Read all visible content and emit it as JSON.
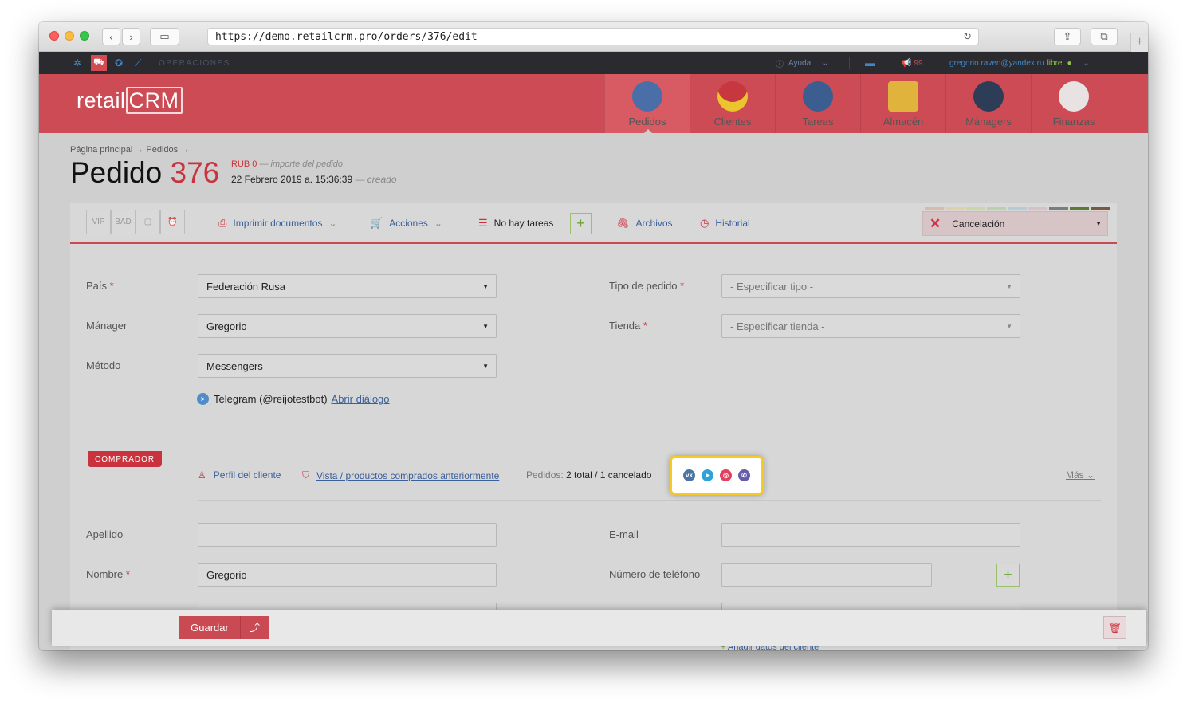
{
  "browser": {
    "url": "https://demo.retailcrm.pro/orders/376/edit",
    "back_icon": "chevron-left-icon",
    "forward_icon": "chevron-right-icon"
  },
  "topnav": {
    "section": "OPERACIONES",
    "help": "Ayuda",
    "notifications": "99",
    "user_email": "gregorio.raven@yandex.ru",
    "user_status": "libre"
  },
  "header": {
    "logo": "retailCRM",
    "modules": [
      "Pedidos",
      "Clientes",
      "Tareas",
      "Almacén",
      "Mánagers",
      "Finanzas"
    ]
  },
  "page": {
    "breadcrumb": "Página principal → Pedidos →",
    "title": "Pedido",
    "order_number": "376",
    "amount": "RUB 0",
    "amount_note": "— importe del pedido",
    "created": "22 Febrero 2019 a. 15:36:39",
    "created_note": "— creado"
  },
  "toolbar": {
    "flags": [
      "VIP",
      "BAD"
    ],
    "print": "Imprimir documentos",
    "actions": "Acciones",
    "tasks": "No hay tareas",
    "files": "Archivos",
    "history": "Historial",
    "status": "Cancelación",
    "status_colors": [
      "#d9b9a7",
      "#e1cfa6",
      "#cbd6a5",
      "#b9d3a8",
      "#b3cdd6",
      "#d9c0c4",
      "#7c7c7c",
      "#5b7a3a",
      "#7a5a3a"
    ]
  },
  "form": {
    "country_label": "País",
    "country_value": "Federación Rusa",
    "manager_label": "Mánager",
    "manager_value": "Gregorio",
    "method_label": "Método",
    "method_value": "Messengers",
    "order_type_label": "Tipo de pedido",
    "order_type_placeholder": "- Especificar tipo -",
    "shop_label": "Tienda",
    "shop_placeholder": "- Especificar tienda -",
    "telegram_text": "Telegram (@reijotestbot)",
    "telegram_link": "Abrir diálogo"
  },
  "customer": {
    "section": "COMPRADOR",
    "profile_link": "Perfil del cliente",
    "purchased_link": "Vista / productos comprados anteriormente",
    "orders_label": "Pedidos:",
    "orders_value": "2 total / 1 cancelado",
    "more": "Más",
    "lastname_label": "Apellido",
    "email_label": "E-mail",
    "name_label": "Nombre",
    "name_value": "Gregorio",
    "phone_label": "Número de teléfono",
    "add_data": "Añadir datos del cliente",
    "social_icons": [
      "vk-icon",
      "telegram-icon",
      "instagram-icon",
      "viber-icon"
    ]
  },
  "footer": {
    "save": "Guardar"
  }
}
